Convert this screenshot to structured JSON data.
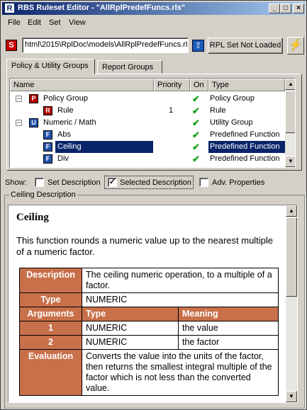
{
  "window": {
    "title": "RBS Ruleset Editor - \"AllRplPredefFuncs.rls\"",
    "app_icon": "R"
  },
  "menu": [
    "File",
    "Edit",
    "Set",
    "View"
  ],
  "toolbar": {
    "path_value": "html\\2015\\RplDoc\\models\\AllRplPredefFuncs.rls",
    "rpl_button": "RPL Set Not Loaded"
  },
  "tabs": [
    "Policy & Utility Groups",
    "Report Groups"
  ],
  "tree": {
    "columns": [
      "Name",
      "Priority",
      "On",
      "Type"
    ],
    "rows": [
      {
        "name": "Policy Group",
        "icon": "P",
        "priority": "",
        "on": "✔",
        "type": "Policy Group"
      },
      {
        "name": "Rule",
        "icon": "R",
        "priority": "1",
        "on": "✔",
        "type": "Rule"
      },
      {
        "name": "Numeric / Math",
        "icon": "U",
        "priority": "",
        "on": "✔",
        "type": "Utility Group"
      },
      {
        "name": "Abs",
        "icon": "F",
        "priority": "",
        "on": "✔",
        "type": "Predefined Function"
      },
      {
        "name": "Ceiling",
        "icon": "F",
        "priority": "",
        "on": "✔",
        "type": "Predefined Function",
        "selected": true
      },
      {
        "name": "Div",
        "icon": "F",
        "priority": "",
        "on": "✔",
        "type": "Predefined Function"
      }
    ]
  },
  "show": {
    "label": "Show:",
    "options": [
      {
        "label": "Set Description",
        "checked": false
      },
      {
        "label": "Selected Description",
        "checked": true
      },
      {
        "label": "Adv. Properties",
        "checked": false
      }
    ]
  },
  "description": {
    "group_title": "Ceiling Description",
    "heading": "Ceiling",
    "summary": "This function rounds a numeric value up to the nearest multiple of a numeric factor.",
    "table": {
      "description_label": "Description",
      "description_value": "The ceiling numeric operation, to a multiple of a factor.",
      "type_label": "Type",
      "type_value": "NUMERIC",
      "arguments_label": "Arguments",
      "arg_type_header": "Type",
      "arg_meaning_header": "Meaning",
      "args": [
        {
          "n": "1",
          "type": "NUMERIC",
          "meaning": "the value"
        },
        {
          "n": "2",
          "type": "NUMERIC",
          "meaning": "the factor"
        }
      ],
      "evaluation_label": "Evaluation",
      "evaluation_value": "Converts the value into the units of the factor, then returns the smallest integral multiple of the factor which is not less than the converted value."
    }
  },
  "colors": {
    "title_start": "#0a246a",
    "selection": "#0a246a",
    "table_header": "#c8704a",
    "check": "#1aa01a"
  }
}
